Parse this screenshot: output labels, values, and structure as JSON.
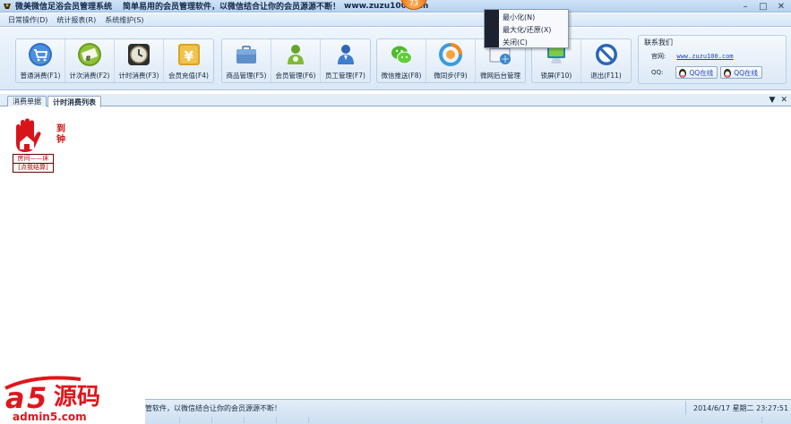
{
  "window": {
    "title": "微美微信足浴会员管理系统",
    "slogan": "简单易用的会员管理软件，以微信结合让你的会员源源不断！",
    "url": "www.zuzu100.com",
    "speed_badge": "73",
    "controls": [
      "–",
      "□",
      "✕"
    ]
  },
  "menu": [
    "日常操作(D)",
    "统计报表(R)",
    "系统维护(S)"
  ],
  "toolbar": {
    "groups": [
      [
        {
          "name": "normal-consume",
          "icon": "cart-icon",
          "label": "普通消费(F1)"
        },
        {
          "name": "count-consume",
          "icon": "ticket-icon",
          "label": "计次消费(F2)"
        },
        {
          "name": "timed-consume",
          "icon": "clock-icon",
          "label": "计时消费(F3)"
        },
        {
          "name": "member-recharge",
          "icon": "yen-icon",
          "label": "会员充值(F4)"
        }
      ],
      [
        {
          "name": "goods-manage",
          "icon": "briefcase-icon",
          "label": "商品管理(F5)"
        },
        {
          "name": "member-manage",
          "icon": "member-icon",
          "label": "会员管理(F6)"
        },
        {
          "name": "staff-manage",
          "icon": "staff-icon",
          "label": "员工管理(F7)"
        }
      ],
      [
        {
          "name": "wechat-push",
          "icon": "wechat-icon",
          "label": "微信推送(F8)"
        },
        {
          "name": "wechat-sync",
          "icon": "sync-icon",
          "label": "微同步(F9)"
        },
        {
          "name": "web-backend",
          "icon": "web-admin-icon",
          "label": "微网后台管理"
        }
      ],
      [
        {
          "name": "lock-screen",
          "icon": "monitor-icon",
          "label": "锁屏(F10)"
        },
        {
          "name": "exit",
          "icon": "exit-icon",
          "label": "退出(F11)"
        }
      ]
    ]
  },
  "contact": {
    "title": "联系我们",
    "site_label": "官网:",
    "site_url": "www.zuzu100.com",
    "qq_label": "QQ:",
    "qq_buttons": [
      "QQ在线",
      "QQ在线"
    ]
  },
  "tabs": [
    {
      "label": "消费单据",
      "active": false
    },
    {
      "label": "计时消费列表",
      "active": true
    }
  ],
  "tab_controls": [
    "▼",
    "✕"
  ],
  "content": {
    "arrive_label": "到钟",
    "checkout_label": "房间——床",
    "checkout_sub": "[点我结算]"
  },
  "context_menu": [
    "最小化(N)",
    "最大化/还原(X)",
    "关闭(C)"
  ],
  "status": {
    "message": "管软件，以微信结合让你的会员源源不断！",
    "datetime": "2014/6/17 星期二 23:27:51"
  },
  "watermark": {
    "brand": "源码",
    "url": "admin5.com"
  },
  "colors": {
    "accent": "#1b44c9",
    "toolbar_bg": "#dbe8f6",
    "alert_red": "#cc1111"
  }
}
